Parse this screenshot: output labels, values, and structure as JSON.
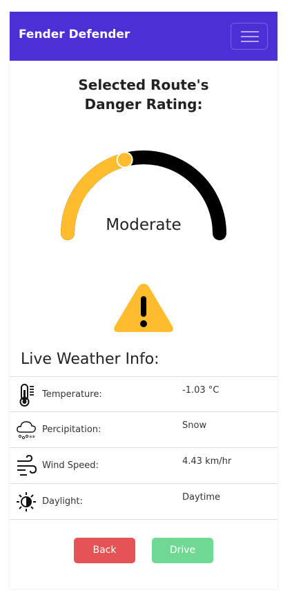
{
  "navbar": {
    "brand": "Fender Defender",
    "toggle_icon": "hamburger-icon",
    "color": "#4e2fd6"
  },
  "rating": {
    "title_line1": "Selected Route's",
    "title_line2": "Danger Rating:",
    "level_label": "Moderate",
    "gauge_fraction": 0.42,
    "fill_color": "#ffbd2e",
    "track_color": "#000000",
    "warning_icon": "warning-triangle-icon"
  },
  "weather": {
    "title": "Live Weather Info:",
    "rows": [
      {
        "icon": "thermometer-icon",
        "label": "Temperature:",
        "value": "-1.03 °C"
      },
      {
        "icon": "snow-cloud-icon",
        "label": "Percipitation:",
        "value": "Snow"
      },
      {
        "icon": "wind-icon",
        "label": "Wind Speed:",
        "value": "4.43 km/hr"
      },
      {
        "icon": "half-sun-icon",
        "label": "Daylight:",
        "value": "Daytime"
      }
    ]
  },
  "actions": {
    "back_label": "Back",
    "drive_label": "Drive",
    "back_color": "#e45454",
    "drive_color": "#6fd892"
  }
}
